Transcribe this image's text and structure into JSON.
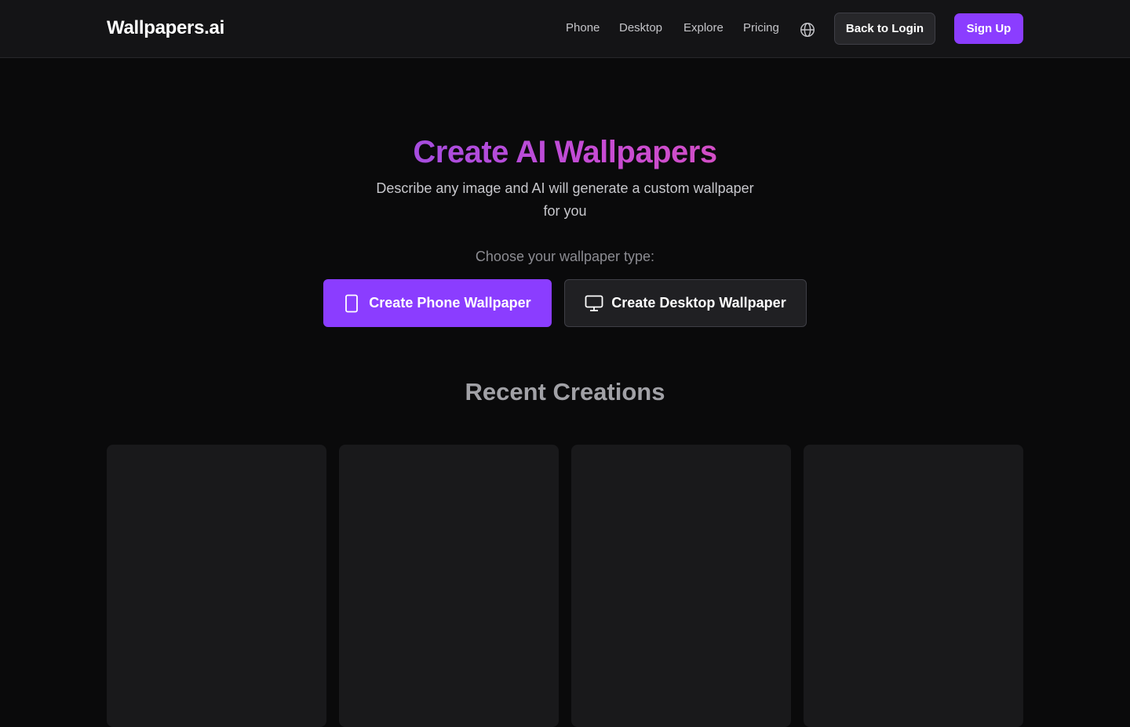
{
  "header": {
    "logo": "Wallpapers.ai",
    "nav": [
      "Phone",
      "Desktop",
      "Explore",
      "Pricing"
    ],
    "language_icon": "globe-icon",
    "back_to_login": "Back to Login",
    "sign_up": "Sign Up"
  },
  "hero": {
    "title": "Create AI Wallpapers",
    "subtitle": "Describe any image and AI will generate a custom wallpaper for you",
    "choose_label": "Choose your wallpaper type:",
    "phone_button": "Create Phone Wallpaper",
    "phone_icon": "smartphone-icon",
    "desktop_button": "Create Desktop Wallpaper",
    "desktop_icon": "monitor-icon"
  },
  "recent": {
    "title": "Recent Creations"
  },
  "colors": {
    "accent": "#8b3dff",
    "background": "#0a0a0b",
    "header_bg": "#141416",
    "card_bg": "#19191b",
    "title_gradient_start": "#a64ddf",
    "title_gradient_end": "#d24ec6"
  }
}
